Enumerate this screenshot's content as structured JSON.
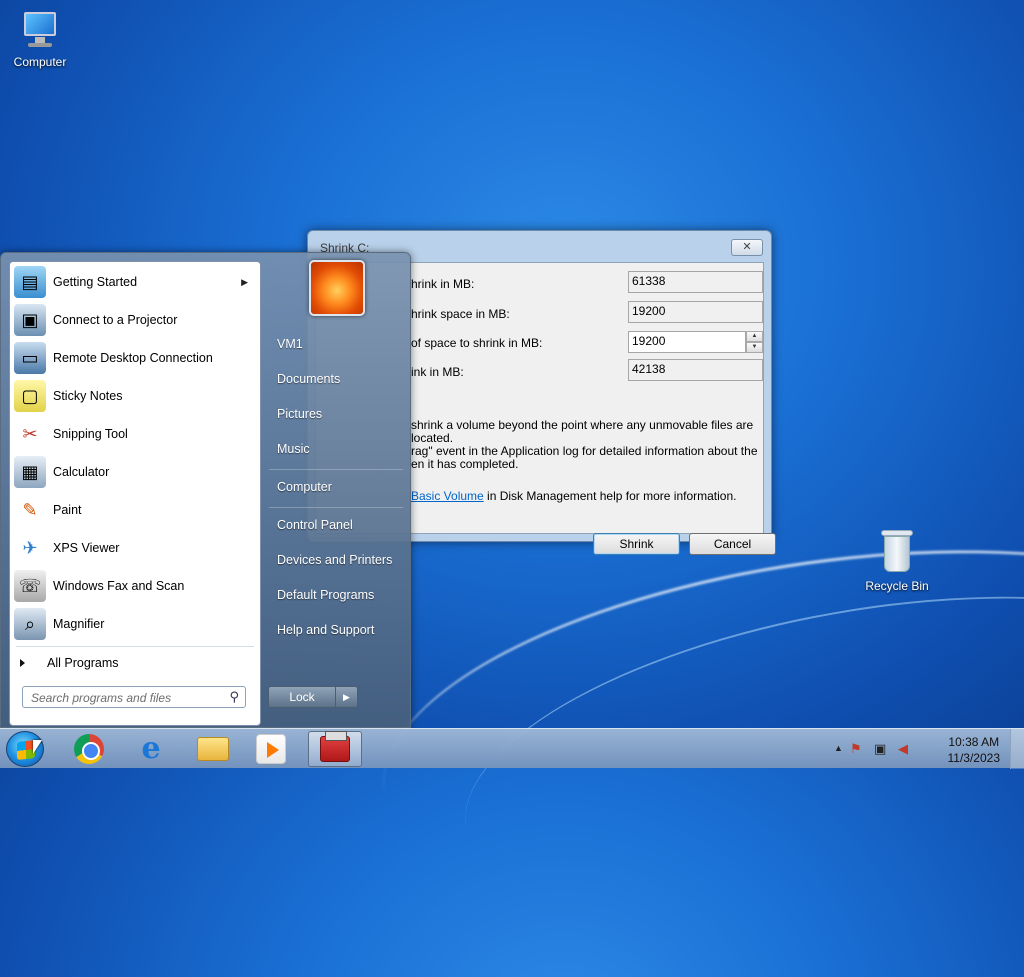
{
  "desktop": {
    "icons": [
      {
        "label": "Computer"
      },
      {
        "label": "Recycle Bin"
      }
    ]
  },
  "dialog": {
    "title": "Shrink C:",
    "close_label": "✕",
    "rows": [
      {
        "label": "hrink in MB:",
        "value": "61338"
      },
      {
        "label": "hrink space in MB:",
        "value": "19200"
      },
      {
        "label": "of space to shrink in MB:",
        "value": "19200"
      },
      {
        "label": "ink in MB:",
        "value": "42138"
      }
    ],
    "note_lines": [
      "shrink a volume beyond the point where any unmovable files are located.",
      "rag\" event in the Application log for detailed information about the",
      "en it has completed."
    ],
    "help_link": "Basic Volume",
    "help_suffix": " in Disk Management help for more information.",
    "buttons": {
      "shrink": "Shrink",
      "cancel": "Cancel"
    }
  },
  "start_menu": {
    "programs": [
      {
        "label": "Getting Started",
        "icon": "getting-started-icon",
        "has_submenu": true
      },
      {
        "label": "Connect to a Projector",
        "icon": "projector-icon"
      },
      {
        "label": "Remote Desktop Connection",
        "icon": "remote-desktop-icon"
      },
      {
        "label": "Sticky Notes",
        "icon": "sticky-notes-icon"
      },
      {
        "label": "Snipping Tool",
        "icon": "scissors-icon"
      },
      {
        "label": "Calculator",
        "icon": "calculator-icon"
      },
      {
        "label": "Paint",
        "icon": "paint-icon"
      },
      {
        "label": "XPS Viewer",
        "icon": "xps-viewer-icon"
      },
      {
        "label": "Windows Fax and Scan",
        "icon": "fax-icon"
      },
      {
        "label": "Magnifier",
        "icon": "magnifier-icon"
      }
    ],
    "all_programs": "All Programs",
    "search_placeholder": "Search programs and files",
    "right_items": [
      {
        "label": "VM1"
      },
      {
        "label": "Documents"
      },
      {
        "label": "Pictures"
      },
      {
        "label": "Music"
      },
      {
        "label": "Computer"
      },
      {
        "label": "Control Panel"
      },
      {
        "label": "Devices and Printers"
      },
      {
        "label": "Default Programs"
      },
      {
        "label": "Help and Support"
      }
    ],
    "lock_label": "Lock"
  },
  "taskbar": {
    "apps": [
      "chrome-icon",
      "internet-explorer-icon",
      "file-explorer-icon",
      "media-player-icon",
      "disk-management-icon"
    ],
    "clock_time": "10:38 AM",
    "clock_date": "11/3/2023",
    "tray_arrow": "▲"
  }
}
